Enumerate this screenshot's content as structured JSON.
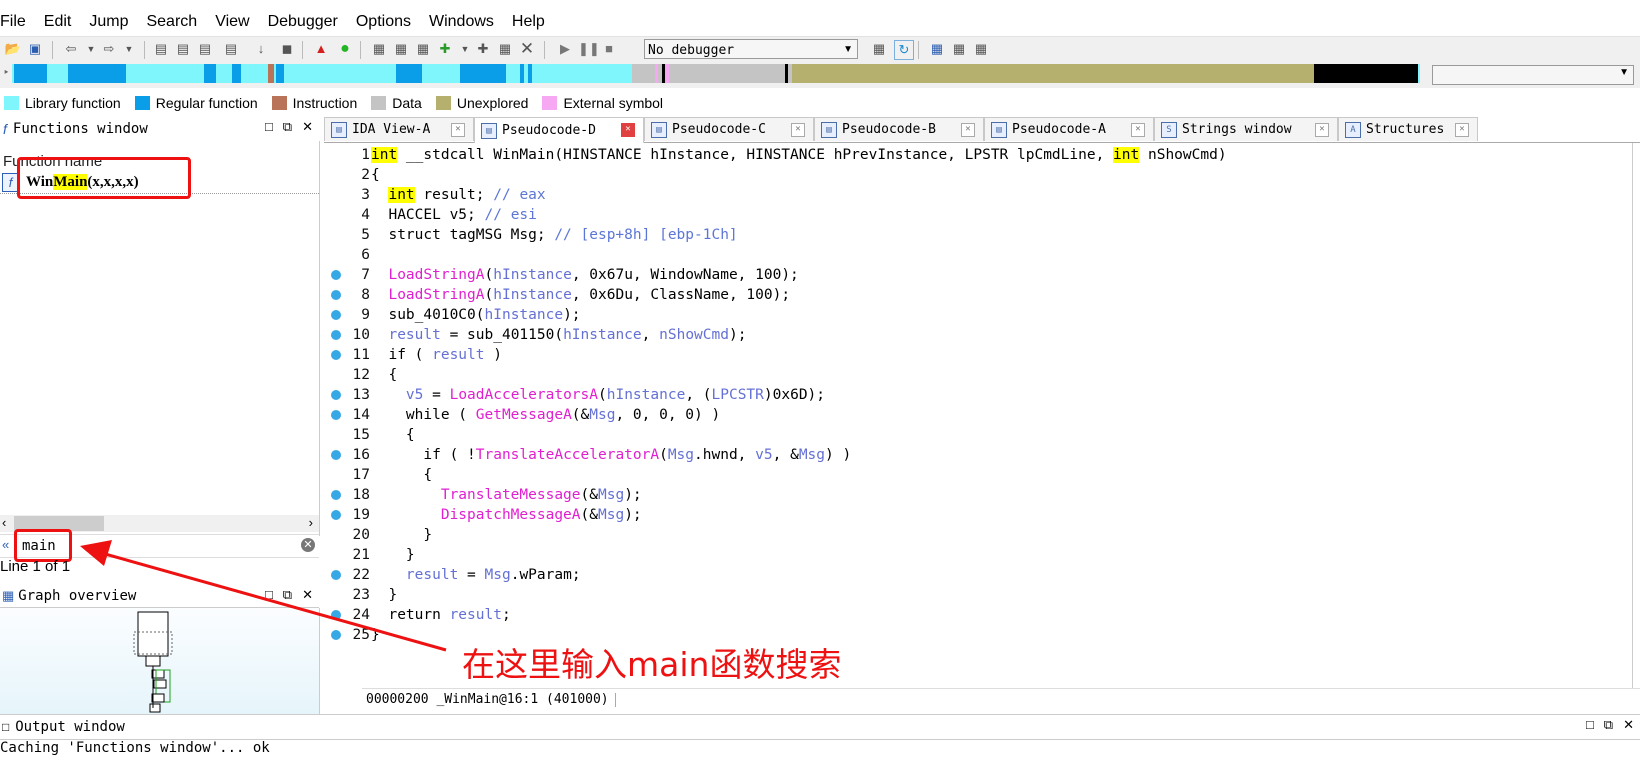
{
  "menu": [
    "File",
    "Edit",
    "Jump",
    "Search",
    "View",
    "Debugger",
    "Options",
    "Windows",
    "Help"
  ],
  "toolbar": {
    "debugger_select": "No debugger"
  },
  "legend": [
    {
      "label": "Library function",
      "color": "#7ff6fb"
    },
    {
      "label": "Regular function",
      "color": "#0a9ee8"
    },
    {
      "label": "Instruction",
      "color": "#b87358"
    },
    {
      "label": "Data",
      "color": "#c4c4c4"
    },
    {
      "label": "Unexplored",
      "color": "#b6b06e"
    },
    {
      "label": "External symbol",
      "color": "#f7a8f2"
    }
  ],
  "functions_window": {
    "title": "Functions window",
    "column_header": "Function name",
    "row_prefix": "Win",
    "row_highlight": "Main",
    "row_suffix": "(x,x,x,x)",
    "search_value": "main",
    "line_status": "Line 1 of 1"
  },
  "graph_overview": {
    "title": "Graph overview"
  },
  "tabs": [
    {
      "label": "IDA View-A",
      "active": false
    },
    {
      "label": "Pseudocode-D",
      "active": true
    },
    {
      "label": "Pseudocode-C",
      "active": false
    },
    {
      "label": "Pseudocode-B",
      "active": false
    },
    {
      "label": "Pseudocode-A",
      "active": false
    },
    {
      "label": "Strings window",
      "active": false
    },
    {
      "label": "Structures",
      "active": false
    }
  ],
  "code": {
    "status": "00000200 _WinMain@16:1 (401000)",
    "line_numbers": [
      "1",
      "2",
      "3",
      "4",
      "5",
      "6",
      "7",
      "8",
      "9",
      "10",
      "11",
      "12",
      "13",
      "14",
      "15",
      "16",
      "17",
      "18",
      "19",
      "20",
      "21",
      "22",
      "23",
      "24",
      "25"
    ]
  },
  "output_window": {
    "title": "Output window",
    "text": "Caching 'Functions window'... ok"
  },
  "annotation": {
    "text": "在这里输入main函数搜索"
  }
}
